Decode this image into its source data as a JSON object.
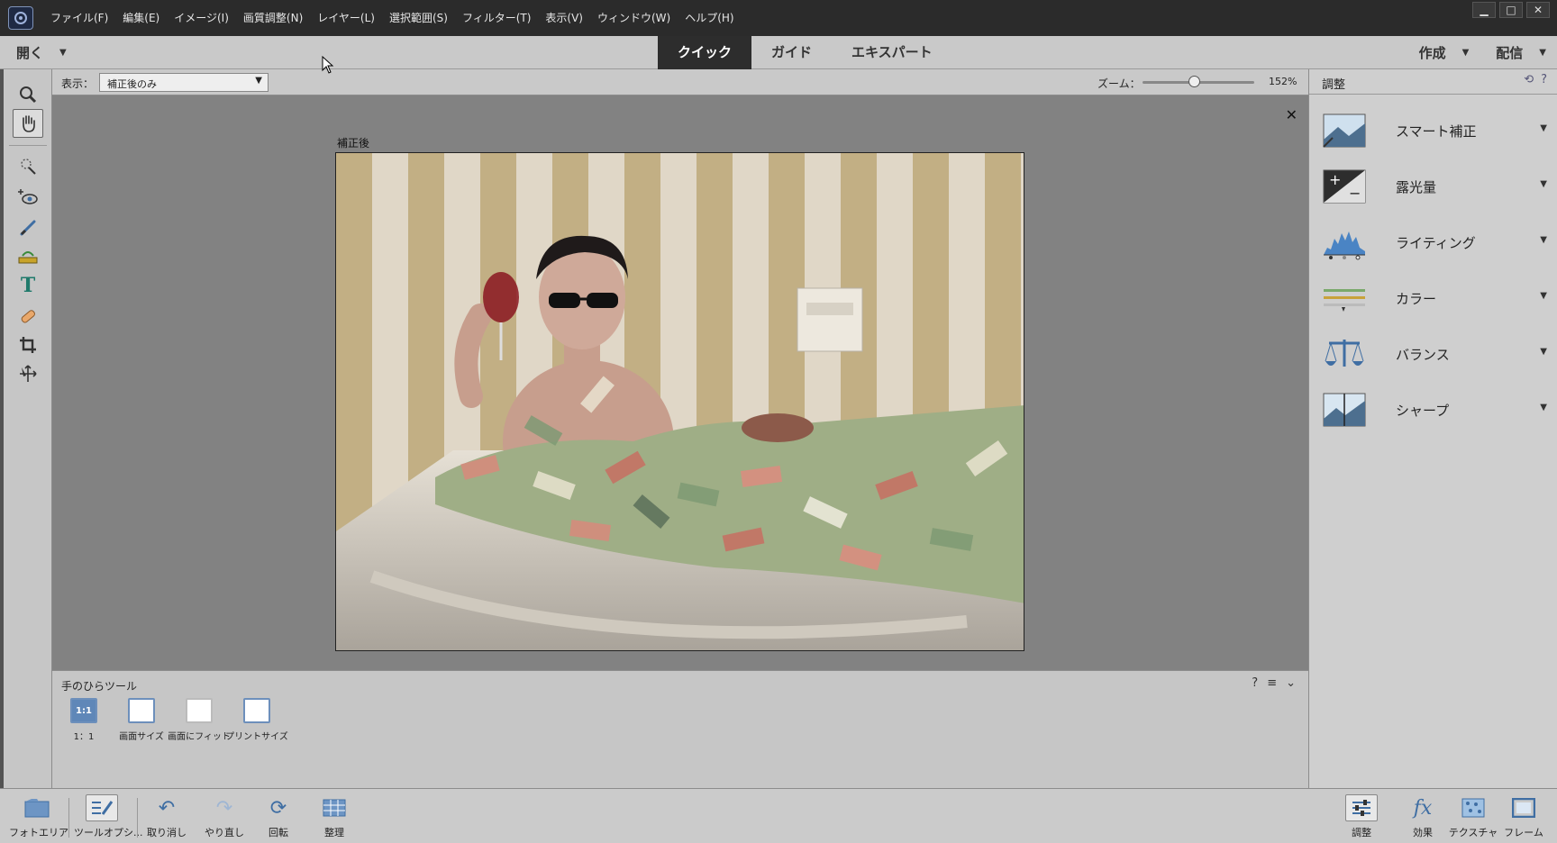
{
  "menu": [
    "ファイル(F)",
    "編集(E)",
    "イメージ(I)",
    "画質調整(N)",
    "レイヤー(L)",
    "選択範囲(S)",
    "フィルター(T)",
    "表示(V)",
    "ウィンドウ(W)",
    "ヘルプ(H)"
  ],
  "window_controls": {
    "minimize": "▁",
    "maximize": "□",
    "close": "✕"
  },
  "modebar": {
    "open_label": "開く",
    "tabs": [
      {
        "label": "クイック",
        "active": true
      },
      {
        "label": "ガイド",
        "active": false
      },
      {
        "label": "エキスパート",
        "active": false
      }
    ],
    "create_label": "作成",
    "share_label": "配信"
  },
  "tools": [
    "zoom-icon",
    "hand-icon",
    "quick-selection-icon",
    "eye-icon",
    "whiten-teeth-icon",
    "straighten-icon",
    "type-icon",
    "spot-healing-icon",
    "crop-icon",
    "move-icon"
  ],
  "options_strip": {
    "view_label": "表示：",
    "view_value": "補正後のみ",
    "zoom_label": "ズーム：",
    "zoom_value": "152%",
    "zoom_level": 0.46
  },
  "canvas": {
    "image_label": "補正後",
    "close_symbol": "✕"
  },
  "tool_options": {
    "title": "手のひらツール",
    "buttons": [
      {
        "label": "1：1",
        "icon_text": "1:1"
      },
      {
        "label": "画面サイズ",
        "icon_text": ""
      },
      {
        "label": "画面にフィット",
        "icon_text": ""
      },
      {
        "label": "プリントサイズ",
        "icon_text": ""
      }
    ]
  },
  "right_panel": {
    "title": "調整",
    "items": [
      {
        "label": "スマート補正",
        "icon": "smart-fix-icon"
      },
      {
        "label": "露光量",
        "icon": "exposure-icon"
      },
      {
        "label": "ライティング",
        "icon": "lighting-icon"
      },
      {
        "label": "カラー",
        "icon": "color-icon"
      },
      {
        "label": "バランス",
        "icon": "balance-icon"
      },
      {
        "label": "シャープ",
        "icon": "sharpen-icon"
      }
    ]
  },
  "bottom_bar": {
    "left": [
      {
        "label": "フォトエリア",
        "icon": "photo-bin-icon"
      },
      {
        "label": "ツールオプシ...",
        "icon": "tool-options-icon"
      },
      {
        "label": "取り消し",
        "icon": "undo-icon"
      },
      {
        "label": "やり直し",
        "icon": "redo-icon"
      },
      {
        "label": "回転",
        "icon": "rotate-icon"
      },
      {
        "label": "整理",
        "icon": "organize-icon"
      }
    ],
    "right": [
      {
        "label": "調整",
        "icon": "adjustments-icon"
      },
      {
        "label": "効果",
        "icon": "effects-icon"
      },
      {
        "label": "テクスチャ",
        "icon": "textures-icon"
      },
      {
        "label": "フレーム",
        "icon": "frames-icon"
      }
    ]
  },
  "colors": {
    "accent": "#3f6ea3",
    "active_tab": "#2d2d2d"
  }
}
